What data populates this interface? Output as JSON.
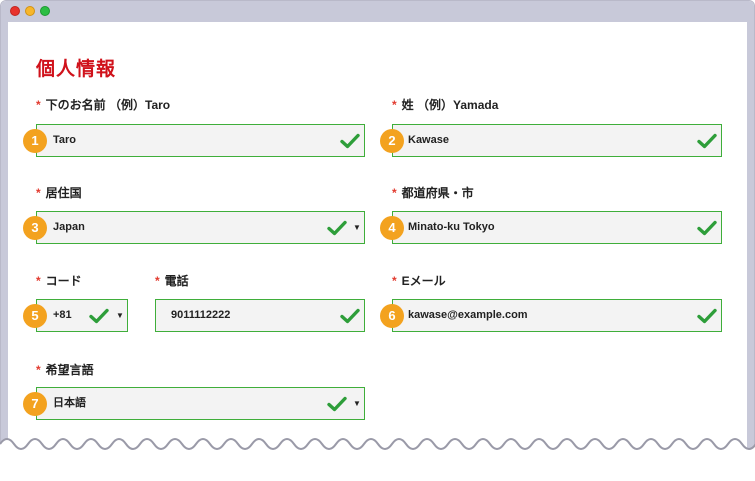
{
  "form": {
    "title": "個人情報",
    "required_mark": "*",
    "fields": {
      "first_name": {
        "label": "下のお名前 （例）Taro",
        "value": "Taro",
        "badge": "1"
      },
      "last_name": {
        "label": "姓 （例）Yamada",
        "value": "Kawase",
        "badge": "2"
      },
      "country": {
        "label": "居住国",
        "value": "Japan",
        "badge": "3"
      },
      "prefecture_city": {
        "label": "都道府県・市",
        "value": "Minato-ku Tokyo",
        "badge": "4"
      },
      "code": {
        "label": "コード",
        "value": "+81",
        "badge": "5"
      },
      "phone": {
        "label": "電話",
        "value": "9011112222"
      },
      "email": {
        "label": "Eメール",
        "value": "kawase@example.com",
        "badge": "6"
      },
      "language": {
        "label": "希望言語",
        "value": "日本語",
        "badge": "7"
      }
    }
  },
  "icons": {
    "valid": "checkmark-icon",
    "dropdown": "caret-down-icon"
  },
  "colors": {
    "title": "#d0121b",
    "required": "#e23a2f",
    "valid_border": "#3fae3a",
    "checkmark": "#2e9e3a",
    "badge": "#f3a21f",
    "field_bg": "#f3f3f3",
    "window_frame": "#c8c9d9"
  }
}
